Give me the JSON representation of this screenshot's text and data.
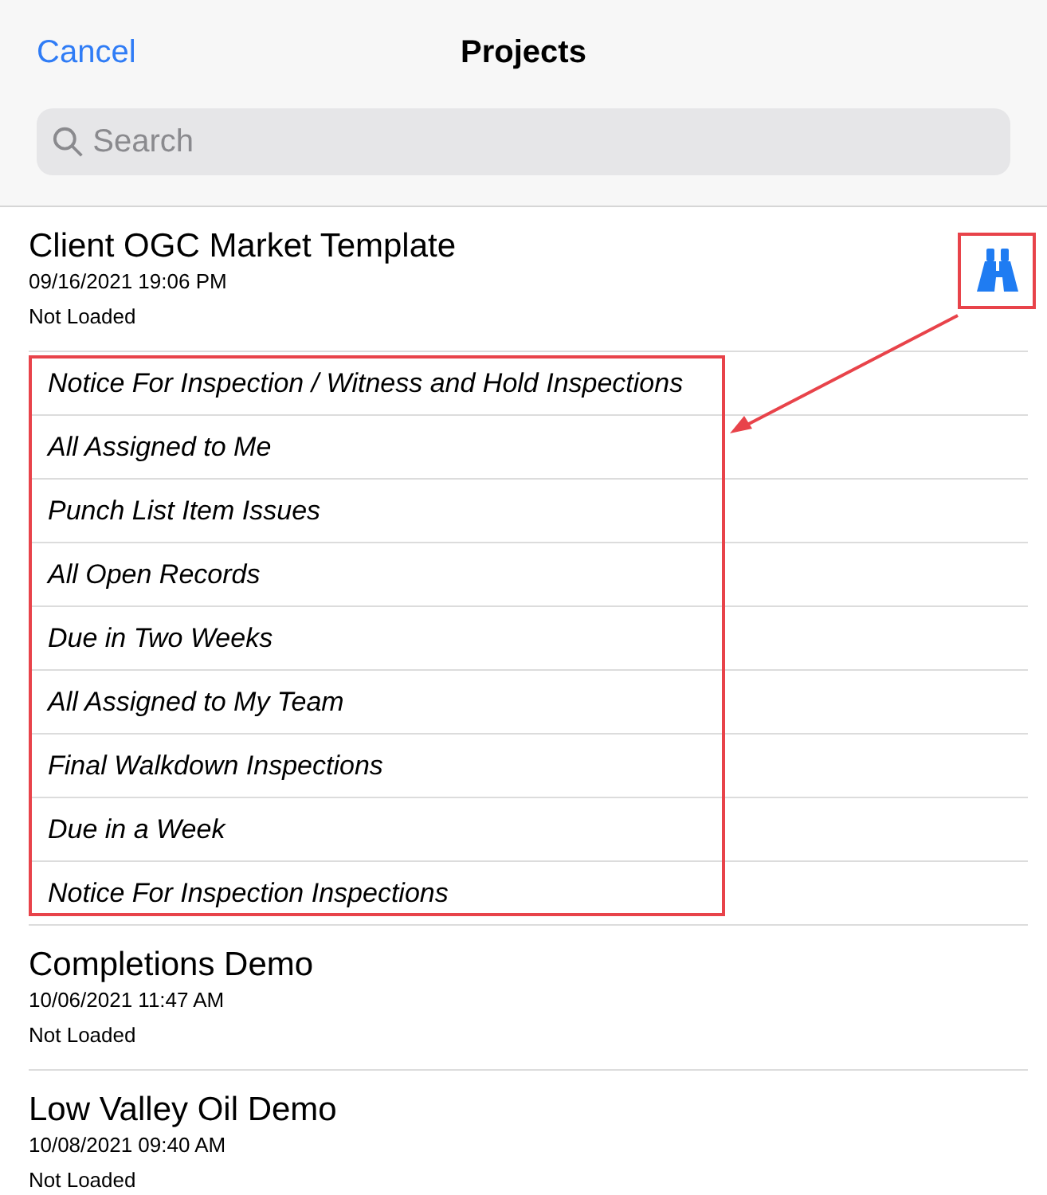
{
  "header": {
    "cancel": "Cancel",
    "title": "Projects"
  },
  "search": {
    "placeholder": "Search"
  },
  "projects": [
    {
      "name": "Client OGC Market Template",
      "date": "09/16/2021 19:06 PM",
      "status": "Not Loaded",
      "expanded": true,
      "queries": [
        "Notice For Inspection / Witness and Hold Inspections",
        "All Assigned to Me",
        "Punch List Item Issues",
        "All Open Records",
        "Due in Two Weeks",
        "All Assigned to My Team",
        "Final Walkdown Inspections",
        "Due in a Week",
        "Notice For Inspection Inspections"
      ]
    },
    {
      "name": "Completions Demo",
      "date": "10/06/2021 11:47 AM",
      "status": "Not Loaded",
      "expanded": false
    },
    {
      "name": "Low Valley Oil Demo",
      "date": "10/08/2021 09:40 AM",
      "status": "Not Loaded",
      "expanded": false
    }
  ]
}
